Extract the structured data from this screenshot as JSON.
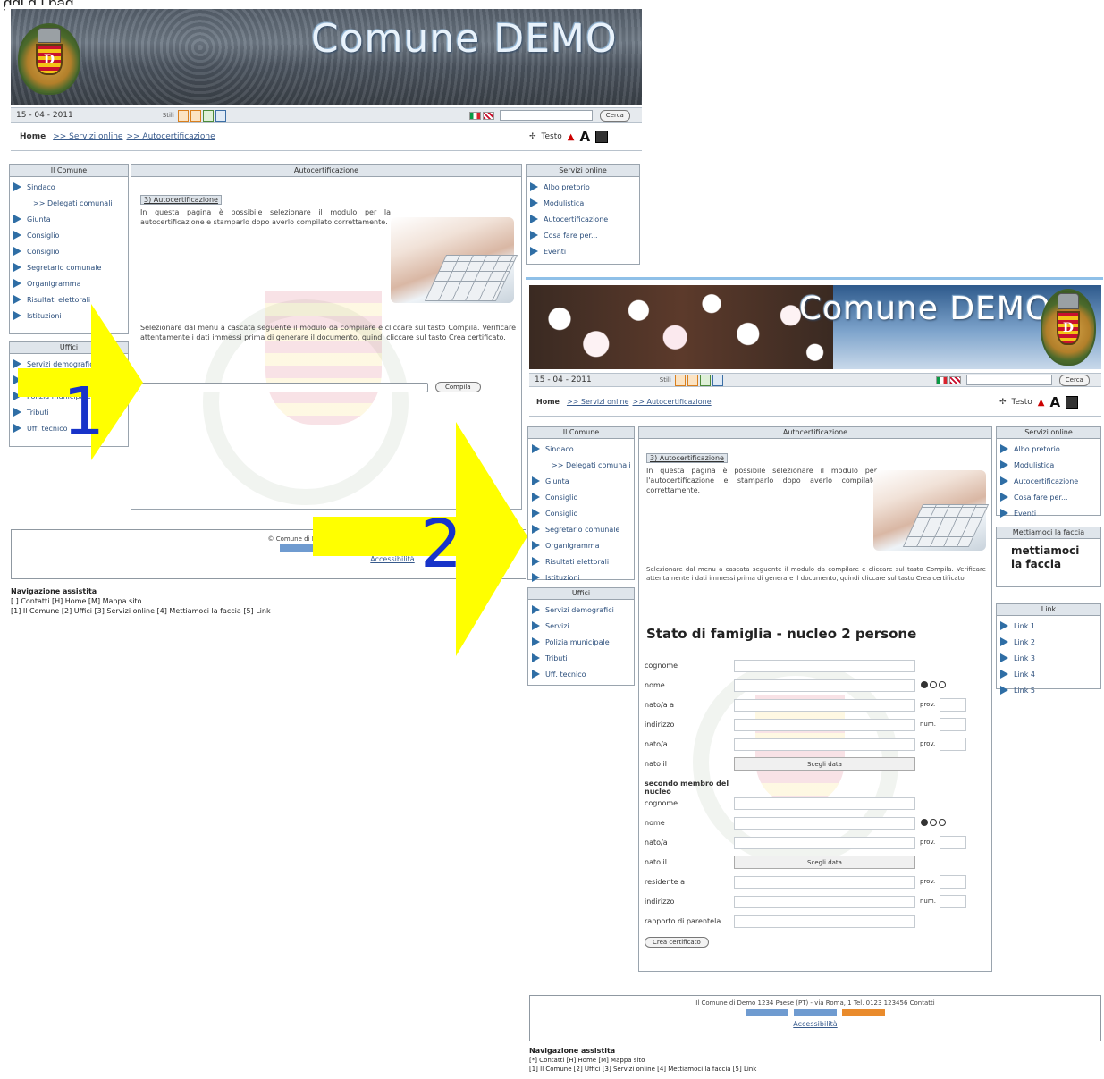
{
  "caption": "ggi g   l  pag",
  "colors": {
    "accent": "#2f6ea5",
    "arrow": "#ffff00",
    "number": "#1733c9"
  },
  "banner": {
    "title": "Comune DEMO"
  },
  "toolbar": {
    "date": "15 - 04 - 2011",
    "icons_label": "Stili",
    "search_button": "Cerca"
  },
  "breadcrumb": {
    "home": "Home",
    "level1": ">> Servizi online",
    "level2": ">> Autocertificazione"
  },
  "accessibility": {
    "big_text": "A",
    "small_text": "▲",
    "other": "Testo"
  },
  "left_menu": {
    "title": "Il Comune",
    "items": [
      "Sindaco",
      ">> Delegati comunali",
      "Giunta",
      "Consiglio",
      "Consiglio",
      "Segretario comunale",
      "Organigramma",
      "Risultati elettorali",
      "Istituzioni"
    ]
  },
  "uffici_menu": {
    "title": "Uffici",
    "items": [
      "Servizi demografici",
      "Servizi",
      "Polizia municipale",
      "Tributi",
      "Uff. tecnico"
    ]
  },
  "servizi_menu": {
    "title": "Servizi online",
    "items": [
      "Albo pretorio",
      "Modulistica",
      "Autocertificazione",
      "Cosa fare per...",
      "Eventi"
    ]
  },
  "content1": {
    "header": "Autocertificazione",
    "tag": "3) Autocertificazione",
    "text": "In questa pagina è possibile selezionare il modulo per la autocertificazione e stamparlo dopo averlo compilato correttamente.",
    "instructions": "Selezionare dal menu a cascata seguente il modulo da compilare e cliccare sul tasto Compila. Verificare attentamente i dati immessi prima di generare il documento, quindi cliccare sul tasto Crea certificato.",
    "button": "Compila"
  },
  "footer1": {
    "text": "© Comune di Demo 1234 Paese (PT)",
    "link": "Accessibilità"
  },
  "navmode1": {
    "title": "Navigazione assistita",
    "line1": "[.] Contatti [H] Home [M] Mappa sito",
    "line2": "[1] Il Comune [2] Uffici [3] Servizi online [4] Mettiamoci la faccia [5] Link"
  },
  "labels": {
    "num1": "1",
    "num2": "2"
  },
  "content2": {
    "header": "Autocertificazione",
    "tag": "3) Autocertificazione",
    "text": "In questa pagina è possibile selezionare il modulo per l'autocertificazione e stamparlo dopo averlo compilato correttamente.",
    "instructions": "Selezionare dal menu a cascata seguente il modulo da compilare e cliccare sul tasto Compila. Verificare attentamente i dati immessi prima di generare il documento, quindi cliccare sul tasto Crea certificato.",
    "form_title": "Stato di famiglia - nucleo 2 persone",
    "fields": [
      {
        "label": "cognome",
        "side": ""
      },
      {
        "label": "nome",
        "side": "radio"
      },
      {
        "label": "nato/a a",
        "side": "prov."
      },
      {
        "label": "indirizzo",
        "side": "num."
      },
      {
        "label": "nato/a",
        "side": "prov."
      },
      {
        "label": "nato il",
        "side": "calendario"
      },
      {
        "label": "secondo membro del nucleo",
        "side": ""
      },
      {
        "label": "cognome",
        "side": ""
      },
      {
        "label": "nome",
        "side": "radio"
      },
      {
        "label": "nato/a",
        "side": "prov."
      },
      {
        "label": "nato il",
        "side": "calendario"
      },
      {
        "label": "residente a",
        "side": "prov."
      },
      {
        "label": "indirizzo",
        "side": "num."
      },
      {
        "label": "rapporto di parentela",
        "side": ""
      }
    ],
    "calendar_label": "Scegli data",
    "submit": "Crea certificato"
  },
  "promo": {
    "title": "Mettiamoci la faccia",
    "text1": "mettiamoci",
    "text2": "la faccia"
  },
  "link_box": {
    "title": "Link",
    "items": [
      "Link 1",
      "Link 2",
      "Link 3",
      "Link 4",
      "Link 5"
    ]
  },
  "footer2": {
    "text": "Il Comune di Demo 1234 Paese (PT) - via Roma, 1 Tel. 0123 123456 Contatti",
    "link": "Accessibilità"
  },
  "navmode2": {
    "title": "Navigazione assistita",
    "line1": "[*] Contatti [H] Home [M] Mappa sito",
    "line2": "[1] Il Comune [2] Uffici [3] Servizi online [4] Mettiamoci la faccia [5] Link"
  }
}
